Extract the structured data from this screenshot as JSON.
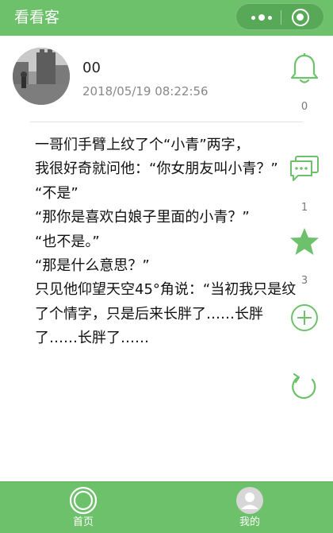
{
  "header": {
    "title": "看看客",
    "capsule": {
      "more_icon": "more-dots-icon",
      "close_icon": "target-close-icon"
    }
  },
  "post": {
    "author": "00",
    "timestamp": "2018/05/19 08:22:56",
    "content": "一哥们手臂上纹了个“小青”两字，\n我很好奇就问他：“你女朋友叫小青？”\n“不是”\n“那你是喜欢白娘子里面的小青？”\n“也不是。”\n“那是什么意思？”\n只见他仰望天空45°角说：“当初我只是纹了个情字，只是后来长胖了……长胖了……长胖了……"
  },
  "actions": {
    "like": {
      "icon": "bell-icon",
      "count": "0"
    },
    "comment": {
      "icon": "comment-icon",
      "count": "1"
    },
    "favorite": {
      "icon": "star-icon",
      "count": "3"
    },
    "add": {
      "icon": "plus-circle-icon"
    },
    "refresh": {
      "icon": "refresh-icon"
    }
  },
  "tabbar": {
    "home": {
      "label": "首页",
      "icon": "home-ring-icon"
    },
    "mine": {
      "label": "我的",
      "icon": "user-avatar-icon"
    }
  },
  "colors": {
    "brand": "#6cc16a",
    "brand_dark": "#58a957",
    "text": "#111111",
    "muted": "#888888",
    "icon_green": "#6cc16a"
  }
}
